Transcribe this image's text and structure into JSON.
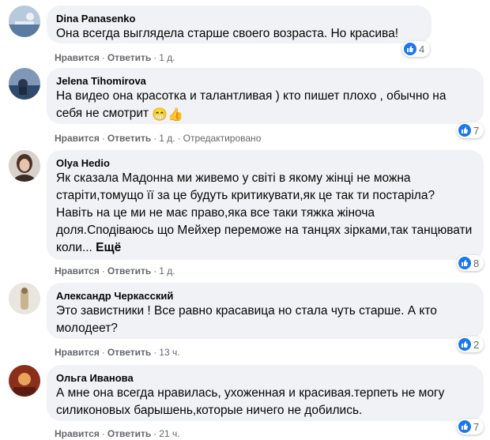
{
  "ui": {
    "like_label": "Нравится",
    "reply_label": "Ответить",
    "separator": "·",
    "more_label": "Ещё"
  },
  "colors": {
    "bubble": "#f0f2f5",
    "meta": "#65676b",
    "like_blue": "#1877f2"
  },
  "comments": [
    {
      "author": "Dina Panasenko",
      "text": "Она всегда выглядела старше своего возраста. Но красива!",
      "time": "1 д.",
      "reactions": "4",
      "avatar_icon": "profile-photo-landscape"
    },
    {
      "author": "Jelena Tihomirova",
      "text": "На видео она красотка и талантливая ) кто пишет плохо , обычно на себя не смотрит",
      "emoji": "😁👍",
      "time": "1 д.",
      "edited": "Отредактировано",
      "reactions": "7",
      "avatar_icon": "profile-photo-sea"
    },
    {
      "author": "Olya Hedio",
      "text": "Як сказала Мадонна ми живемо у світі в якому жінці не можна старіти,томущо її за це будуть критикувати,як це так ти постаріла? Навіть на це ми не має право,яка все таки тяжка жіноча доля.Сподіваюсь що Мейхер переможе на танцях зірками,так танцювати коли...",
      "time": "1 д.",
      "reactions": "8",
      "avatar_icon": "profile-photo-woman"
    },
    {
      "author": "Александр Черкасский",
      "text": "Это завистники ! Все равно красавица но стала чуть старше. А кто молодеет?",
      "time": "13 ч.",
      "reactions": "2",
      "avatar_icon": "profile-photo-figure"
    },
    {
      "author": "Ольга Иванова",
      "text": "А мне она всегда нравилась, ухоженная и красивая.терпеть не могу силиконовых барышень,которые ничего не добились.",
      "time": "21 ч.",
      "reactions": "7",
      "avatar_icon": "profile-photo-warm"
    }
  ]
}
